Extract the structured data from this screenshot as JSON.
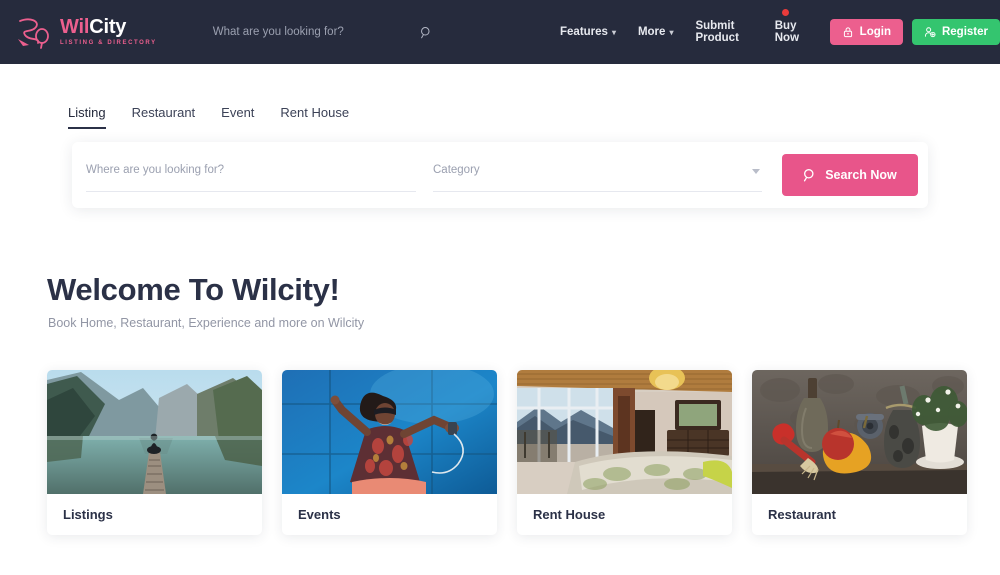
{
  "header": {
    "logo": {
      "mark": "wilcity-swoosh-logo",
      "name_part1": "Wil",
      "name_part2": "City",
      "tagline": "LISTING & DIRECTORY"
    },
    "search": {
      "placeholder": "What are you looking for?",
      "icon": "search-icon"
    },
    "nav": [
      {
        "label": "Features",
        "has_chevron": true,
        "has_dot": false
      },
      {
        "label": "More",
        "has_chevron": true,
        "has_dot": false
      },
      {
        "label": "Submit Product",
        "has_chevron": false,
        "has_dot": false
      },
      {
        "label": "Buy Now",
        "has_chevron": false,
        "has_dot": true
      }
    ],
    "login": {
      "label": "Login",
      "icon": "lock-icon",
      "color": "#ec5f8e"
    },
    "register": {
      "label": "Register",
      "icon": "user-add-icon",
      "color": "#34c56f"
    },
    "background_color": "#262b3d"
  },
  "tabs": [
    {
      "label": "Listing",
      "active": true
    },
    {
      "label": "Restaurant",
      "active": false
    },
    {
      "label": "Event",
      "active": false
    },
    {
      "label": "Rent House",
      "active": false
    }
  ],
  "search_form": {
    "location": {
      "placeholder": "Where are you looking for?",
      "value": ""
    },
    "category": {
      "placeholder": "Category",
      "value": "",
      "icon": "chevron-down-icon"
    },
    "submit": {
      "label": "Search Now",
      "icon": "search-icon",
      "color": "#e8558a"
    }
  },
  "welcome": {
    "title": "Welcome To Wilcity!",
    "subtitle": "Book Home, Restaurant, Experience and more on Wilcity"
  },
  "categories": [
    {
      "label": "Listings",
      "image": "lake-mountain-dock-photo"
    },
    {
      "label": "Events",
      "image": "woman-dancing-blue-wall-photo"
    },
    {
      "label": "Rent House",
      "image": "bedroom-mountain-view-photo"
    },
    {
      "label": "Restaurant",
      "image": "rustic-fruit-still-life-photo"
    }
  ],
  "theme": {
    "accent_pink": "#ec5f8e",
    "accent_green": "#34c56f",
    "dark_navy": "#262b3d",
    "text_muted": "#9296a5"
  }
}
